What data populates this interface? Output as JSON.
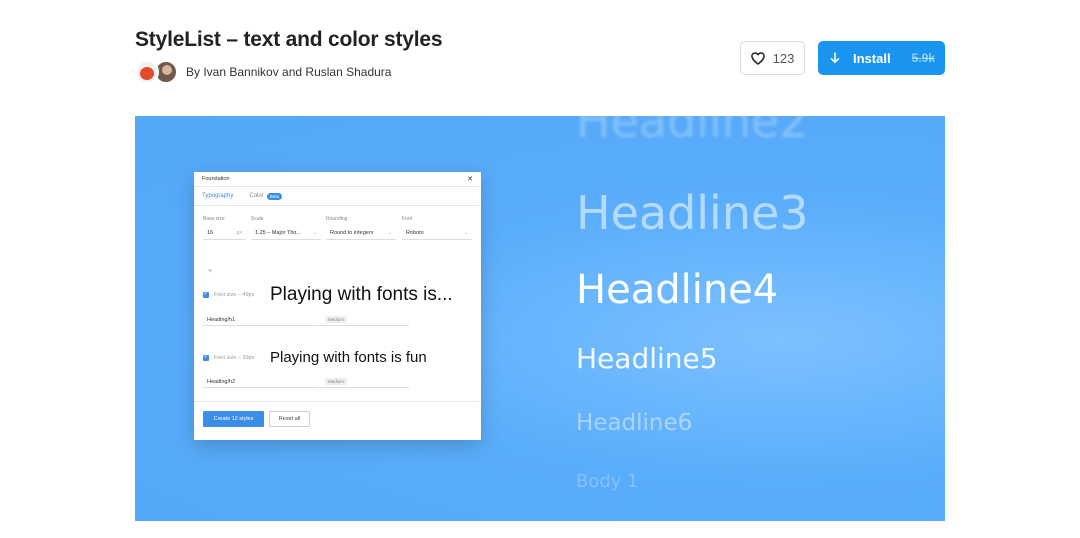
{
  "plugin": {
    "title": "StyleList – text and color styles",
    "byline": "By Ivan Bannikov and Ruslan Shadura",
    "likes": "123",
    "install_label": "Install",
    "install_count": "5.9k"
  },
  "hero": {
    "headlines": [
      "Headline2",
      "Headline3",
      "Headline4",
      "Headline5",
      "Headline6",
      "Body 1"
    ],
    "modal": {
      "title": "Foundation",
      "close": "✕",
      "tabs": {
        "typography": "Typography",
        "color": "Color",
        "color_badge": "Beta"
      },
      "labels": {
        "base_size": "Base size",
        "scale": "Scale",
        "rounding": "Rounding",
        "font": "Font"
      },
      "values": {
        "base_size": "16",
        "base_unit": "px",
        "scale": "1.25 – Major Thir...",
        "rounding": "Round to integers",
        "font": "Roboto"
      },
      "plus": "+",
      "rows": [
        {
          "size_label": "Font size – 49px",
          "preview": "Playing with fonts is...",
          "style_name": "Heading/h1",
          "weight": "Medium"
        },
        {
          "size_label": "Font size – 39px",
          "preview": "Playing with fonts is fun",
          "style_name": "Heading/h2",
          "weight": "Medium"
        }
      ],
      "create_button": "Create 12 styles",
      "reset_button": "Reset all"
    }
  },
  "colors": {
    "accent": "#1a95ef",
    "hero_bg": "#5aadfb"
  }
}
